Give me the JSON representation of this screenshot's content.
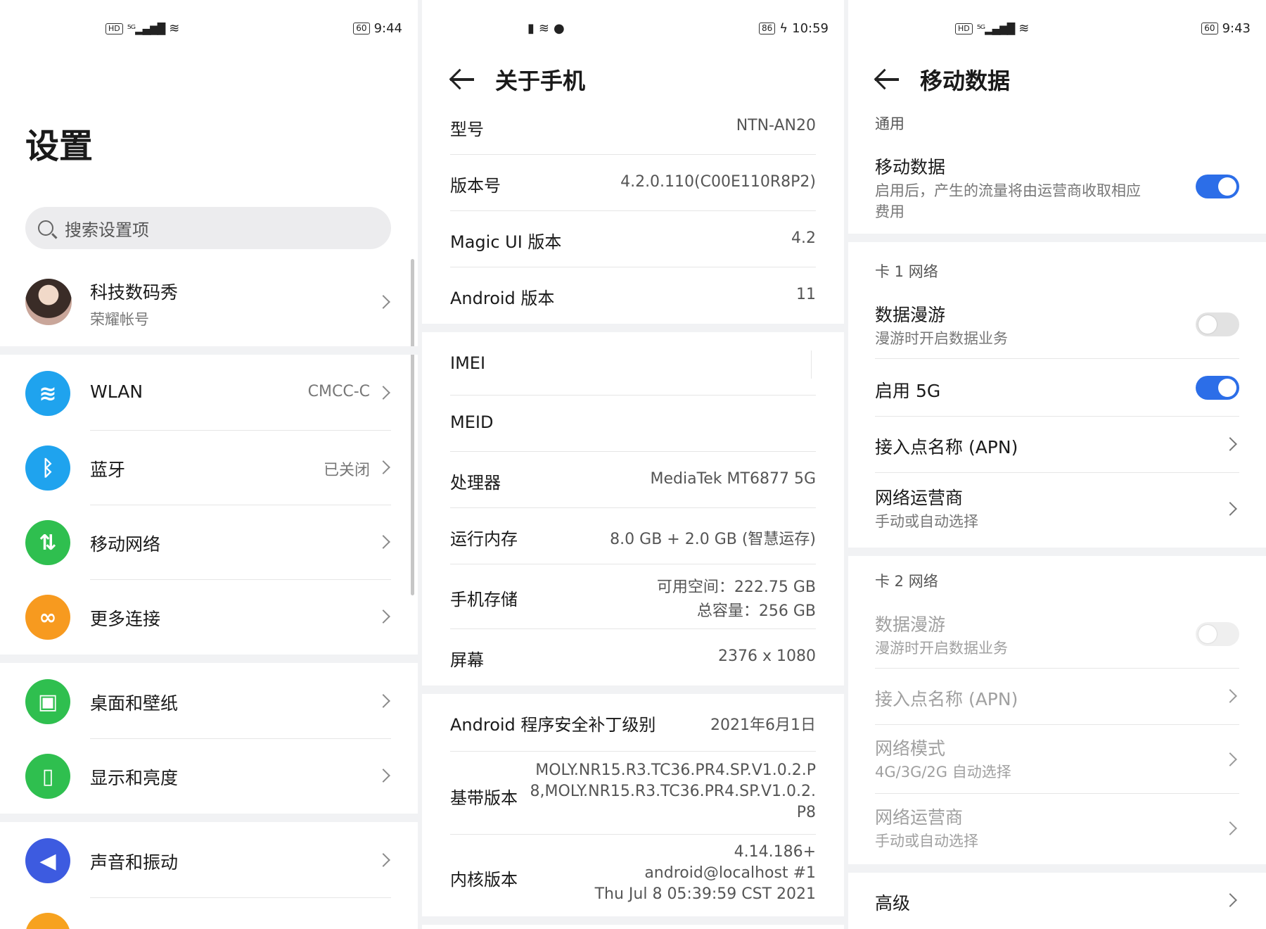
{
  "colors": {
    "accent": "#2c6ee8",
    "wlan": "#1fa3ee",
    "bluetooth": "#1fa3ee",
    "mobile": "#2fbf4f",
    "more": "#f79a1f",
    "desktop": "#2fbf4f",
    "display": "#2fbf4f",
    "sound": "#3d5be0",
    "next": "#f7a21f"
  },
  "settings": {
    "status": {
      "time": "9:44",
      "battery": "60",
      "hd": "HD",
      "net": "5G"
    },
    "title": "设置",
    "search_placeholder": "搜索设置项",
    "account": {
      "name": "科技数码秀",
      "sub": "荣耀帐号"
    },
    "items": [
      {
        "label": "WLAN",
        "value": "CMCC-C",
        "icon": "wifi-icon",
        "glyph": "≋"
      },
      {
        "label": "蓝牙",
        "value": "已关闭",
        "icon": "bluetooth-icon",
        "glyph": "ᛒ"
      },
      {
        "label": "移动网络",
        "value": "",
        "icon": "mobile-data-icon",
        "glyph": "⇅"
      },
      {
        "label": "更多连接",
        "value": "",
        "icon": "link-icon",
        "glyph": "∞"
      },
      {
        "label": "桌面和壁纸",
        "value": "",
        "icon": "wallpaper-icon",
        "glyph": "▣"
      },
      {
        "label": "显示和亮度",
        "value": "",
        "icon": "display-icon",
        "glyph": "▯"
      },
      {
        "label": "声音和振动",
        "value": "",
        "icon": "sound-icon",
        "glyph": "◀"
      }
    ]
  },
  "about": {
    "status": {
      "time": "10:59",
      "battery": "86"
    },
    "title": "关于手机",
    "rows": [
      {
        "k": "型号",
        "v": "NTN-AN20"
      },
      {
        "k": "版本号",
        "v": "4.2.0.110(C00E110R8P2)"
      },
      {
        "k": "Magic UI 版本",
        "v": "4.2"
      },
      {
        "k": "Android 版本",
        "v": "11"
      },
      {
        "k": "IMEI",
        "v": ""
      },
      {
        "k": "MEID",
        "v": ""
      },
      {
        "k": "处理器",
        "v": "MediaTek MT6877 5G"
      },
      {
        "k": "运行内存",
        "v": "8.0 GB + 2.0 GB (智慧运存)"
      },
      {
        "k": "手机存储",
        "v": "可用空间：222.75  GB",
        "v2": "总容量：256  GB"
      },
      {
        "k": "屏幕",
        "v": "2376 x 1080"
      },
      {
        "k": "Android 程序安全补丁级别",
        "v": "2021年6月1日"
      },
      {
        "k": "基带版本",
        "v": "MOLY.NR15.R3.TC36.PR4.SP.V1.0.2.P",
        "v2": "8,MOLY.NR15.R3.TC36.PR4.SP.V1.0.2.",
        "v3": "P8"
      },
      {
        "k": "内核版本",
        "v": "4.14.186+",
        "v2": "android@localhost #1",
        "v3": "Thu Jul 8 05:39:59 CST 2021"
      }
    ]
  },
  "mobile": {
    "status": {
      "time": "9:43",
      "battery": "60",
      "hd": "HD",
      "net": "5G"
    },
    "title": "移动数据",
    "general": "通用",
    "mobile_data": {
      "k": "移动数据",
      "s1": "启用后，产生的流量将由运营商收取相应",
      "s2": "费用",
      "on": true
    },
    "card1": "卡 1 网络",
    "roam1": {
      "k": "数据漫游",
      "s": "漫游时开启数据业务",
      "on": false
    },
    "enable5g": {
      "k": "启用 5G",
      "on": true
    },
    "apn1": "接入点名称 (APN)",
    "carrier1": {
      "k": "网络运营商",
      "s": "手动或自动选择"
    },
    "card2": "卡 2 网络",
    "roam2": {
      "k": "数据漫游",
      "s": "漫游时开启数据业务",
      "on": false
    },
    "apn2": "接入点名称 (APN)",
    "mode2": {
      "k": "网络模式",
      "s": "4G/3G/2G 自动选择"
    },
    "carrier2": {
      "k": "网络运营商",
      "s": "手动或自动选择"
    },
    "advanced": "高级"
  }
}
